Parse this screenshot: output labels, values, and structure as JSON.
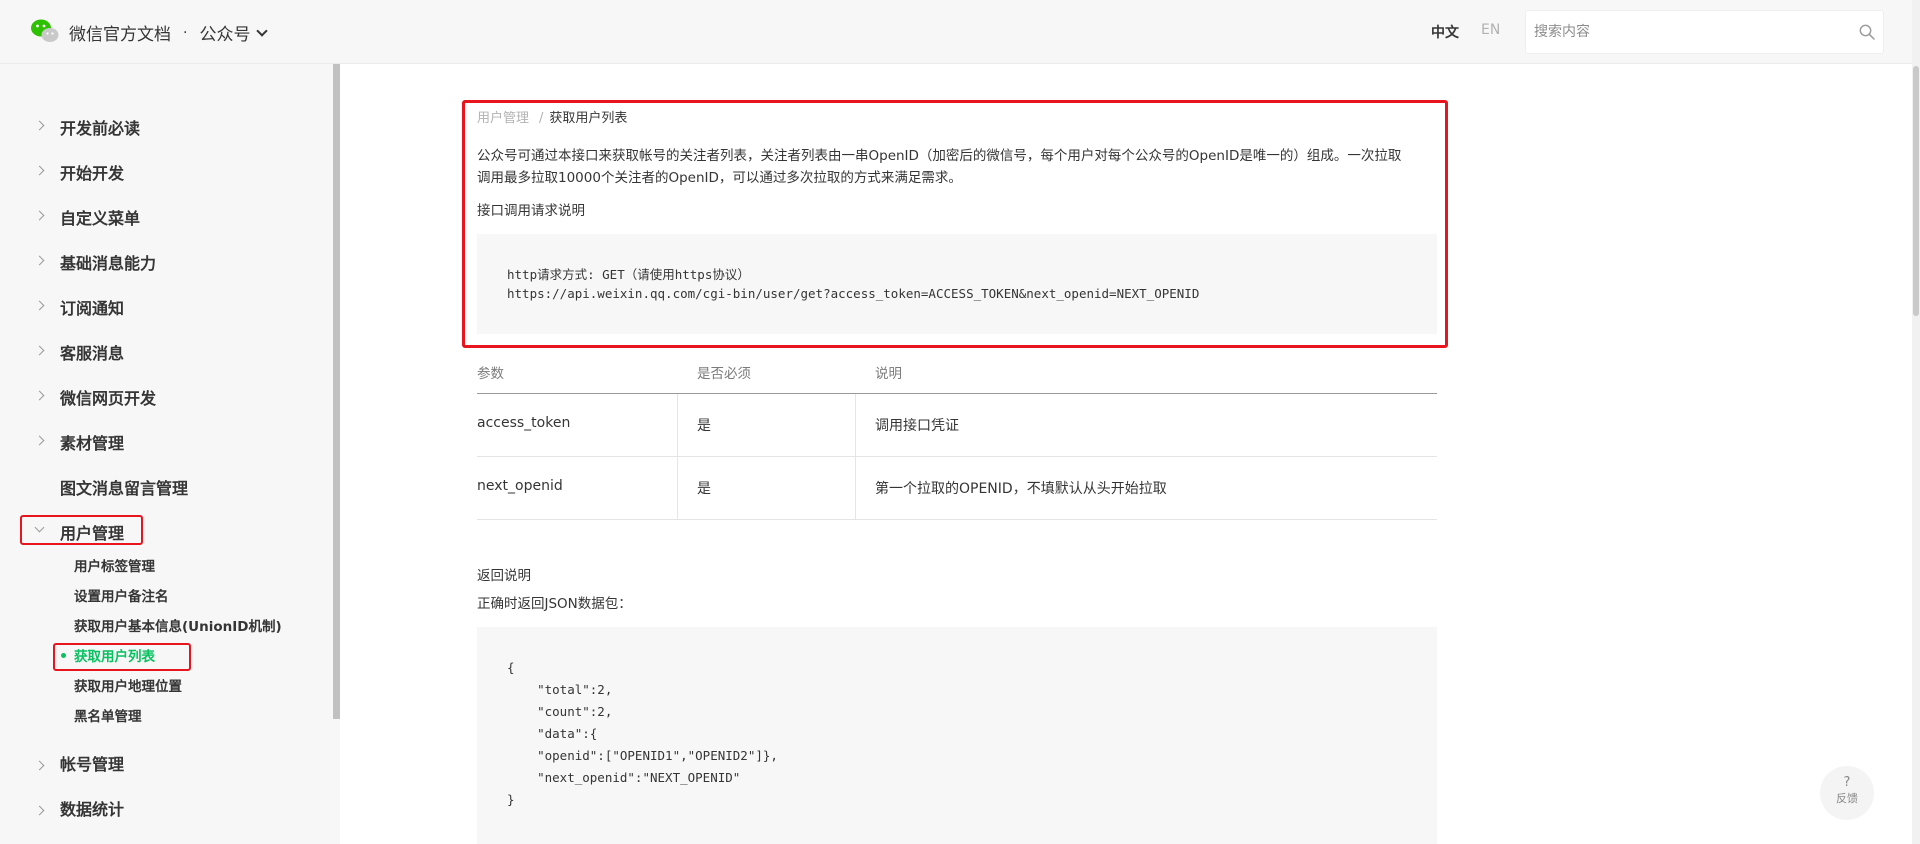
{
  "header": {
    "brand_title": "微信官方文档",
    "separator": "·",
    "section": "公众号",
    "lang_zh": "中文",
    "lang_en": "EN",
    "search_placeholder": "搜索内容"
  },
  "sidebar": {
    "items": [
      {
        "label": "开发前必读"
      },
      {
        "label": "开始开发"
      },
      {
        "label": "自定义菜单"
      },
      {
        "label": "基础消息能力"
      },
      {
        "label": "订阅通知"
      },
      {
        "label": "客服消息"
      },
      {
        "label": "微信网页开发"
      },
      {
        "label": "素材管理"
      },
      {
        "label": "图文消息留言管理"
      },
      {
        "label": "用户管理"
      },
      {
        "label": "帐号管理"
      },
      {
        "label": "数据统计"
      }
    ],
    "sub_items": [
      {
        "label": "用户标签管理"
      },
      {
        "label": "设置用户备注名"
      },
      {
        "label": "获取用户基本信息(UnionID机制)"
      },
      {
        "label": "获取用户列表"
      },
      {
        "label": "获取用户地理位置"
      },
      {
        "label": "黑名单管理"
      }
    ]
  },
  "main": {
    "breadcrumb_parent": "用户管理",
    "breadcrumb_sep": "/",
    "breadcrumb_current": "获取用户列表",
    "intro_line1": "公众号可通过本接口来获取帐号的关注者列表，关注者列表由一串OpenID（加密后的微信号，每个用户对每个公众号的OpenID是唯一的）组成。一次拉取",
    "intro_line2": "调用最多拉取10000个关注者的OpenID，可以通过多次拉取的方式来满足需求。",
    "request_label": "接口调用请求说明",
    "request_code": [
      "http请求方式: GET（请使用https协议）",
      "https://api.weixin.qq.com/cgi-bin/user/get?access_token=ACCESS_TOKEN&next_openid=NEXT_OPENID"
    ],
    "table": {
      "headers": [
        "参数",
        "是否必须",
        "说明"
      ],
      "rows": [
        [
          "access_token",
          "是",
          "调用接口凭证"
        ],
        [
          "next_openid",
          "是",
          "第一个拉取的OPENID，不填默认从头开始拉取"
        ]
      ]
    },
    "return_label": "返回说明",
    "return_sub": "正确时返回JSON数据包：",
    "json_code": [
      "{",
      "    \"total\":2,",
      "    \"count\":2,",
      "    \"data\":{",
      "    \"openid\":[\"OPENID1\",\"OPENID2\"]},",
      "    \"next_openid\":\"NEXT_OPENID\"",
      "}"
    ]
  },
  "feedback": {
    "icon_text": "?",
    "label": "反馈"
  },
  "colors": {
    "accent": "#07c160",
    "highlight": "#e8141e",
    "sidebar_bg": "#f7f7f7"
  }
}
